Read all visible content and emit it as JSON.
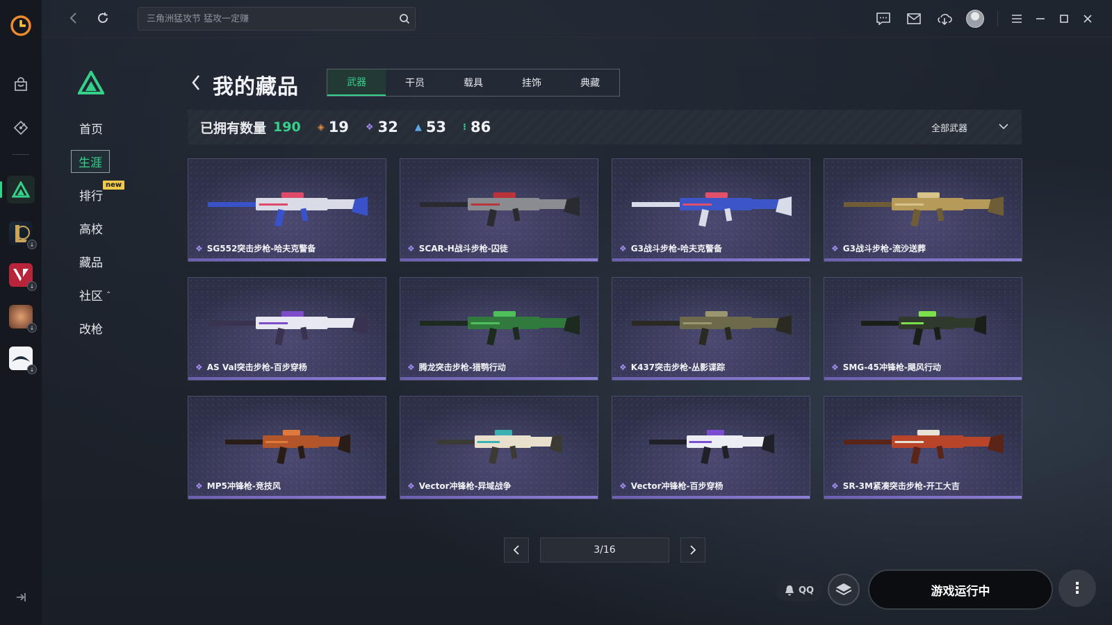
{
  "topbar": {
    "search_placeholder": "三角洲猛攻节 猛攻一定赚"
  },
  "menu": {
    "items": [
      {
        "label": "首页"
      },
      {
        "label": "生涯"
      },
      {
        "label": "排行"
      },
      {
        "label": "高校"
      },
      {
        "label": "藏品"
      },
      {
        "label": "社区"
      },
      {
        "label": "改枪"
      }
    ],
    "new_badge": "new"
  },
  "page": {
    "title": "我的藏品",
    "tabs": [
      "武器",
      "干员",
      "载具",
      "挂饰",
      "典藏"
    ]
  },
  "stats": {
    "owned_label": "已拥有数量",
    "owned_value": "190",
    "rarity_counts": [
      {
        "icon": "gold-diamond-icon",
        "color": "#e08a3c",
        "value": "19"
      },
      {
        "icon": "purple-diamond-icon",
        "color": "#9f86ee",
        "value": "32"
      },
      {
        "icon": "blue-chevron-icon",
        "color": "#5aa9e6",
        "value": "53"
      },
      {
        "icon": "green-dots-icon",
        "color": "#35d18a",
        "value": "86"
      }
    ],
    "filter_label": "全部武器"
  },
  "items": [
    {
      "name": "SG552突击步枪-哈夫克警备",
      "color1": "#d9dbe6",
      "color2": "#3a52c9",
      "accent": "#e04a6a"
    },
    {
      "name": "SCAR-H战斗步枪-囚徒",
      "color1": "#8a8c92",
      "color2": "#2a2b30",
      "accent": "#b8343a"
    },
    {
      "name": "G3战斗步枪-哈夫克警备",
      "color1": "#3c56c8",
      "color2": "#d8dbe8",
      "accent": "#e0506a"
    },
    {
      "name": "G3战斗步枪-流沙送葬",
      "color1": "#b59a5a",
      "color2": "#6e5d36",
      "accent": "#d8c48a"
    },
    {
      "name": "AS Val突击步枪-百步穿杨",
      "color1": "#e8e9f0",
      "color2": "#3a3350",
      "accent": "#7e4cc9"
    },
    {
      "name": "腾龙突击步枪-猎鹗行动",
      "color1": "#2f7a3c",
      "color2": "#1c2a20",
      "accent": "#4fbf5c"
    },
    {
      "name": "K437突击步枪-丛影谍踪",
      "color1": "#6c6a4a",
      "color2": "#2b2a22",
      "accent": "#9a9670"
    },
    {
      "name": "SMG-45冲锋枪-飓风行动",
      "color1": "#2f3a2c",
      "color2": "#1a1f1a",
      "accent": "#7be04a"
    },
    {
      "name": "MP5冲锋枪-竞技风",
      "color1": "#b2552a",
      "color2": "#2a1d18",
      "accent": "#e07a3c"
    },
    {
      "name": "Vector冲锋枪-异域战争",
      "color1": "#e8e0cc",
      "color2": "#3c3a34",
      "accent": "#3ab0b0"
    },
    {
      "name": "Vector冲锋枪-百步穿杨",
      "color1": "#eceef4",
      "color2": "#202028",
      "accent": "#7a4cd0"
    },
    {
      "name": "SR-3M紧凑突击步枪-开工大吉",
      "color1": "#b8452a",
      "color2": "#5a2418",
      "accent": "#e8e2d6"
    }
  ],
  "pagination": {
    "label": "3/16"
  },
  "bottom": {
    "qq_label": "QQ",
    "run_label": "游戏运行中"
  },
  "colors": {
    "accent": "#35d18a",
    "rare_purple": "#a38ef0"
  }
}
